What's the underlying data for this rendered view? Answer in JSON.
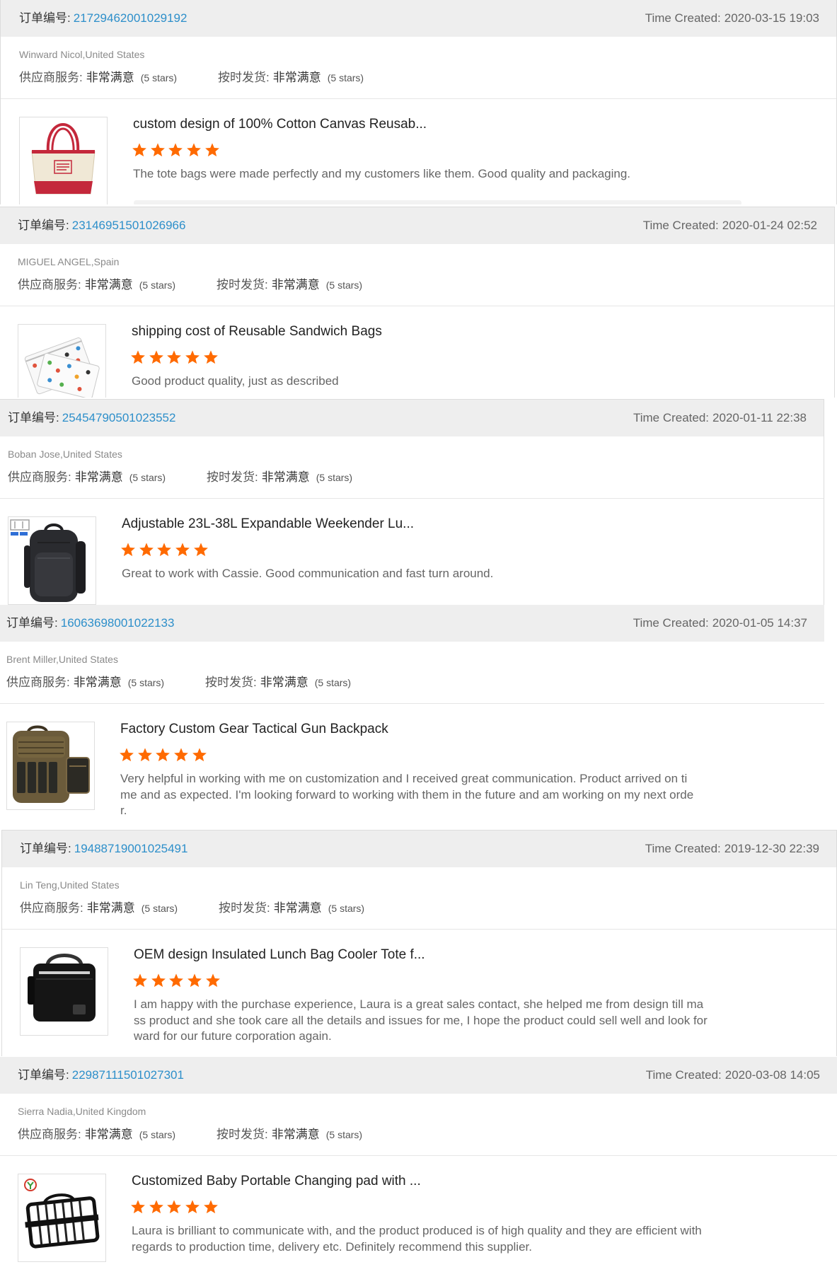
{
  "labels": {
    "order_number": "订单编号:",
    "time_created": "Time Created:",
    "supplier_service": "供应商服务:",
    "on_time_delivery": "按时发货:"
  },
  "colors": {
    "header_bg": "#eeeeee",
    "order_number_link": "#2d8fca",
    "star": "#ff6a00"
  },
  "reviews": [
    {
      "order_number": "21729462001029192",
      "time_created": "2020-03-15 19:03",
      "buyer": "Winward Nicol,United States",
      "supplier_service": "非常满意",
      "supplier_service_stars": "(5 stars)",
      "on_time_delivery": "非常满意",
      "on_time_delivery_stars": "(5 stars)",
      "product_image": "tote-bag",
      "product_title": "custom design of 100% Cotton Canvas Reusab...",
      "rating": 5,
      "review_text": "The tote bags were made perfectly and my customers like them. Good quality and packaging."
    },
    {
      "order_number": "23146951501026966",
      "time_created": "2020-01-24 02:52",
      "buyer": "MIGUEL ANGEL,Spain",
      "supplier_service": "非常满意",
      "supplier_service_stars": "(5 stars)",
      "on_time_delivery": "非常满意",
      "on_time_delivery_stars": "(5 stars)",
      "product_image": "sandwich-bags",
      "product_title": "shipping cost of Reusable Sandwich Bags",
      "rating": 5,
      "review_text": "Good product quality, just as described"
    },
    {
      "order_number": "25454790501023552",
      "time_created": "2020-01-11 22:38",
      "buyer": "Boban Jose,United States",
      "supplier_service": "非常满意",
      "supplier_service_stars": "(5 stars)",
      "on_time_delivery": "非常满意",
      "on_time_delivery_stars": "(5 stars)",
      "product_image": "backpack",
      "product_title": "Adjustable 23L-38L Expandable Weekender Lu...",
      "rating": 5,
      "review_text": "Great to work with Cassie. Good communication and fast turn around."
    },
    {
      "order_number": "16063698001022133",
      "time_created": "2020-01-05 14:37",
      "buyer": "Brent Miller,United States",
      "supplier_service": "非常满意",
      "supplier_service_stars": "(5 stars)",
      "on_time_delivery": "非常满意",
      "on_time_delivery_stars": "(5 stars)",
      "product_image": "tactical-backpack",
      "product_title": "Factory Custom Gear Tactical Gun Backpack",
      "rating": 5,
      "review_text": "Very helpful in working with me on customization and I received great communication. Product arrived on time and as expected. I'm looking forward to working with them in the future and am working on my next order."
    },
    {
      "order_number": "19488719001025491",
      "time_created": "2019-12-30 22:39",
      "buyer": "Lin Teng,United States",
      "supplier_service": "非常满意",
      "supplier_service_stars": "(5 stars)",
      "on_time_delivery": "非常满意",
      "on_time_delivery_stars": "(5 stars)",
      "product_image": "lunch-bag",
      "product_title": "OEM design Insulated Lunch Bag Cooler Tote f...",
      "rating": 5,
      "review_text": "I am happy with the purchase experience, Laura is a great sales contact, she helped me from design till mass product and she took care all the details and issues for me, I hope the product could sell well and look forward for our future corporation again."
    },
    {
      "order_number": "22987111501027301",
      "time_created": "2020-03-08 14:05",
      "buyer": "Sierra Nadia,United Kingdom",
      "supplier_service": "非常满意",
      "supplier_service_stars": "(5 stars)",
      "on_time_delivery": "非常满意",
      "on_time_delivery_stars": "(5 stars)",
      "product_image": "changing-pad",
      "product_title": "Customized Baby Portable Changing pad with ...",
      "rating": 5,
      "review_text": "Laura is brilliant to communicate with, and the product produced is of high quality and they are efficient with regards to production time, delivery etc. Definitely recommend this supplier."
    }
  ]
}
